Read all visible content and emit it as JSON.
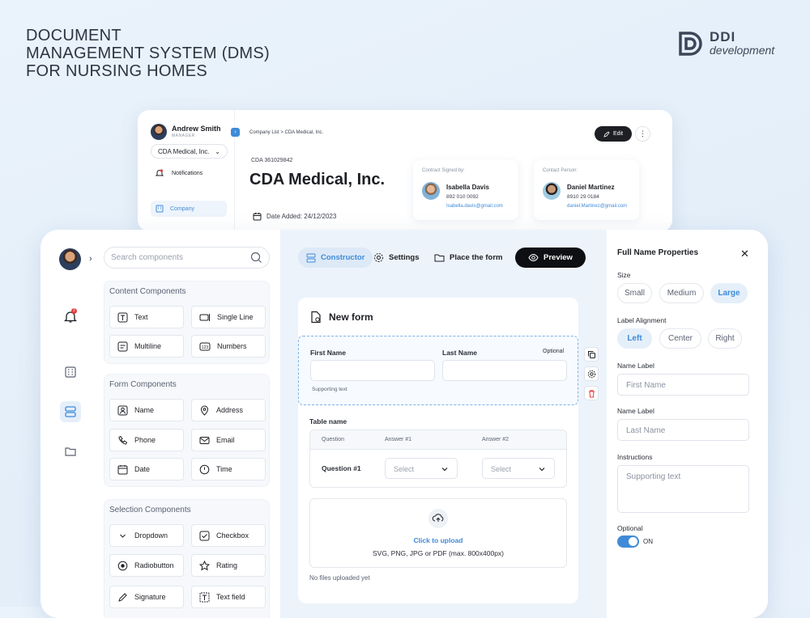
{
  "hero": {
    "line1": "DOCUMENT",
    "line2": "MANAGEMENT SYSTEM (DMS)",
    "line3": "FOR NURSING HOMES"
  },
  "logo": {
    "name": "DDI",
    "sub": "development"
  },
  "company_card": {
    "user_name": "Andrew Smith",
    "user_role": "MANAGER",
    "company_select": "CDA Medical, Inc.",
    "notifications": "Notifications",
    "nav_company": "Company",
    "breadcrumb": "Company List > CDA Medical, Inc.",
    "code": "CDA 361029842",
    "title": "CDA Medical, Inc.",
    "date_added": "Date Added: 24/12/2023",
    "edit_label": "Edit",
    "contacts": [
      {
        "heading": "Contract Signed by:",
        "name": "Isabella Davis",
        "phone": "892 010 0092",
        "email": "Isabella.davis@gmail.com"
      },
      {
        "heading": "Contact Person:",
        "name": "Daniel Martinez",
        "phone": "8910 29 0184",
        "email": "daniel.Martinez@gmail.com"
      }
    ]
  },
  "builder": {
    "search_placeholder": "Search components",
    "notif_count": "2",
    "groups": {
      "content": {
        "title": "Content Components",
        "items": [
          "Text",
          "Single Line",
          "Multiline",
          "Numbers"
        ]
      },
      "form": {
        "title": "Form Components",
        "items": [
          "Name",
          "Address",
          "Phone",
          "Email",
          "Date",
          "Time"
        ]
      },
      "selection": {
        "title": "Selection Components",
        "items": [
          "Dropdown",
          "Checkbox",
          "Radiobutton",
          "Rating",
          "Signature",
          "Text field"
        ]
      }
    },
    "toolbar": {
      "constructor": "Constructor",
      "settings": "Settings",
      "place": "Place the form",
      "preview": "Preview"
    },
    "form": {
      "title": "New form",
      "first_name": "First Name",
      "last_name": "Last Name",
      "optional": "Optional",
      "supporting": "Supporting text",
      "table_name": "Table name",
      "table_headers": [
        "Question",
        "Answer #1",
        "Answer #2"
      ],
      "row_question": "Question #1",
      "select_placeholder": "Select",
      "upload_link": "Click to upload",
      "upload_hint": "SVG, PNG, JPG or PDF (max. 800x400px)",
      "no_files": "No files uploaded yet"
    },
    "properties": {
      "title": "Full Name Properties",
      "size_label": "Size",
      "sizes": [
        "Small",
        "Medium",
        "Large"
      ],
      "align_label": "Label Alignment",
      "aligns": [
        "Left",
        "Center",
        "Right"
      ],
      "name_label_1": "Name Label",
      "name_placeholder_1": "First Name",
      "name_label_2": "Name Label",
      "name_placeholder_2": "Last Name",
      "instructions_label": "Instructions",
      "instructions_placeholder": "Supporting text",
      "optional_label": "Optional",
      "optional_state": "ON"
    }
  },
  "colors": {
    "accent": "#3f8bd8",
    "dark": "#0e0f12",
    "danger": "#e53c3c"
  }
}
